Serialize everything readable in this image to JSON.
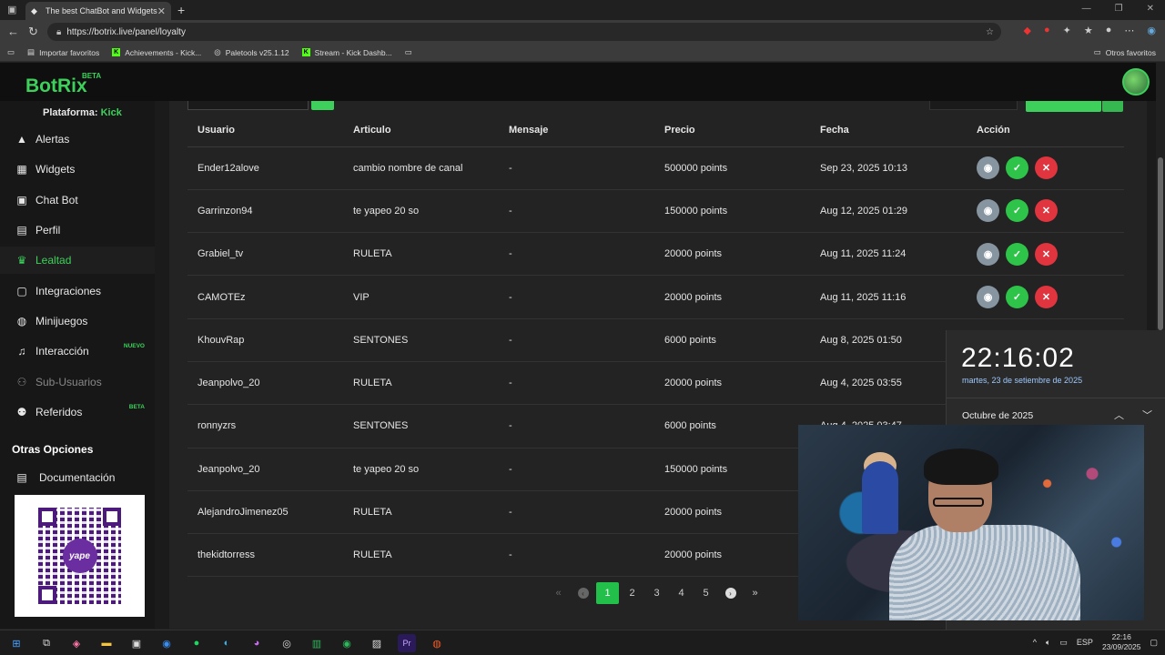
{
  "browser": {
    "tab_title": "The best ChatBot and Widgets fo",
    "url": "https://botrix.live/panel/loyalty",
    "bookmarks": [
      {
        "label": "Importar favoritos"
      },
      {
        "label": "Achievements - Kick..."
      },
      {
        "label": "Paletools v25.1.12"
      },
      {
        "label": "Stream - Kick Dashb..."
      }
    ],
    "other_bookmarks": "Otros favoritos"
  },
  "app": {
    "logo": "BotRix",
    "logo_badge": "BETA",
    "platform_label": "Plataforma:",
    "platform_value": "Kick",
    "accent": "#3dd15b"
  },
  "sidebar": {
    "items": [
      {
        "label": "Alertas",
        "icon": "alert-icon"
      },
      {
        "label": "Widgets",
        "icon": "widgets-icon"
      },
      {
        "label": "Chat Bot",
        "icon": "chatbot-icon"
      },
      {
        "label": "Perfil",
        "icon": "profile-icon"
      },
      {
        "label": "Lealtad",
        "icon": "trophy-icon"
      },
      {
        "label": "Integraciones",
        "icon": "integrations-icon"
      },
      {
        "label": "Minijuegos",
        "icon": "gamepad-icon"
      },
      {
        "label": "Interacción",
        "icon": "music-icon",
        "badge": "NUEVO"
      },
      {
        "label": "Sub-Usuarios",
        "icon": "subusers-icon"
      },
      {
        "label": "Referidos",
        "icon": "referrals-icon",
        "badge": "BETA"
      }
    ],
    "other_options_title": "Otras Opciones",
    "docs_label": "Documentación",
    "qr_label": "yape"
  },
  "table": {
    "headers": [
      "Usuario",
      "Articulo",
      "Mensaje",
      "Precio",
      "Fecha",
      "Acción"
    ],
    "rows": [
      {
        "user": "Ender12alove",
        "item": "cambio nombre de canal",
        "message": "-",
        "price": "500000 points",
        "date": "Sep 23, 2025 10:13"
      },
      {
        "user": "Garrinzon94",
        "item": "te yapeo 20 so",
        "message": "-",
        "price": "150000 points",
        "date": "Aug 12, 2025 01:29"
      },
      {
        "user": "Grabiel_tv",
        "item": "RULETA",
        "message": "-",
        "price": "20000 points",
        "date": "Aug 11, 2025 11:24"
      },
      {
        "user": "CAMOTEz",
        "item": "VIP",
        "message": "-",
        "price": "20000 points",
        "date": "Aug 11, 2025 11:16"
      },
      {
        "user": "KhouvRap",
        "item": "SENTONES",
        "message": "-",
        "price": "6000 points",
        "date": "Aug 8, 2025 01:50"
      },
      {
        "user": "Jeanpolvo_20",
        "item": "RULETA",
        "message": "-",
        "price": "20000 points",
        "date": "Aug 4, 2025 03:55"
      },
      {
        "user": "ronnyzrs",
        "item": "SENTONES",
        "message": "-",
        "price": "6000 points",
        "date": "Aug 4, 2025 03:47"
      },
      {
        "user": "Jeanpolvo_20",
        "item": "te yapeo 20 so",
        "message": "-",
        "price": "150000 points",
        "date": ""
      },
      {
        "user": "AlejandroJimenez05",
        "item": "RULETA",
        "message": "-",
        "price": "20000 points",
        "date": ""
      },
      {
        "user": "thekidtorress",
        "item": "RULETA",
        "message": "-",
        "price": "20000 points",
        "date": ""
      }
    ]
  },
  "pagination": {
    "pages": [
      "1",
      "2",
      "3",
      "4",
      "5"
    ],
    "current": "1"
  },
  "clock": {
    "time": "22:16:02",
    "date": "martes, 23 de setiembre de 2025",
    "month": "Octubre de 2025"
  },
  "taskbar": {
    "lang": "ESP",
    "time": "22:16",
    "date": "23/09/2025"
  }
}
